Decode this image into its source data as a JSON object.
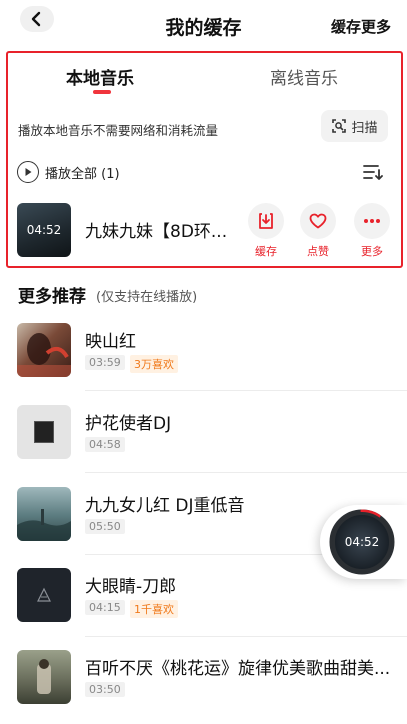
{
  "header": {
    "title": "我的缓存",
    "right_action": "缓存更多"
  },
  "tabs": [
    {
      "label": "本地音乐",
      "active": true
    },
    {
      "label": "离线音乐",
      "active": false
    }
  ],
  "info": {
    "text": "播放本地音乐不需要网络和消耗流量",
    "scan_label": "扫描"
  },
  "play_all": {
    "label": "播放全部 (1)"
  },
  "local_song": {
    "cover_time": "04:52",
    "title": "九妹九妹【8D环...",
    "actions": [
      {
        "label": "缓存",
        "icon": "download-icon"
      },
      {
        "label": "点赞",
        "icon": "heart-icon"
      },
      {
        "label": "更多",
        "icon": "more-icon"
      }
    ]
  },
  "recommend": {
    "title": "更多推荐",
    "subtitle": "(仅支持在线播放)",
    "items": [
      {
        "title": "映山红",
        "duration": "03:59",
        "likes": "3万喜欢"
      },
      {
        "title": "护花使者DJ",
        "duration": "04:58",
        "likes": ""
      },
      {
        "title": "九九女儿红 DJ重低音",
        "duration": "05:50",
        "likes": ""
      },
      {
        "title": "大眼睛-刀郎",
        "duration": "04:15",
        "likes": "1千喜欢"
      },
      {
        "title": "百听不厌《桃花运》旋律优美歌曲甜美...",
        "duration": "03:50",
        "likes": ""
      }
    ]
  },
  "float_player": {
    "time": "04:52"
  },
  "colors": {
    "accent_red": "#e8222b",
    "likes_orange": "#f07a1c"
  }
}
